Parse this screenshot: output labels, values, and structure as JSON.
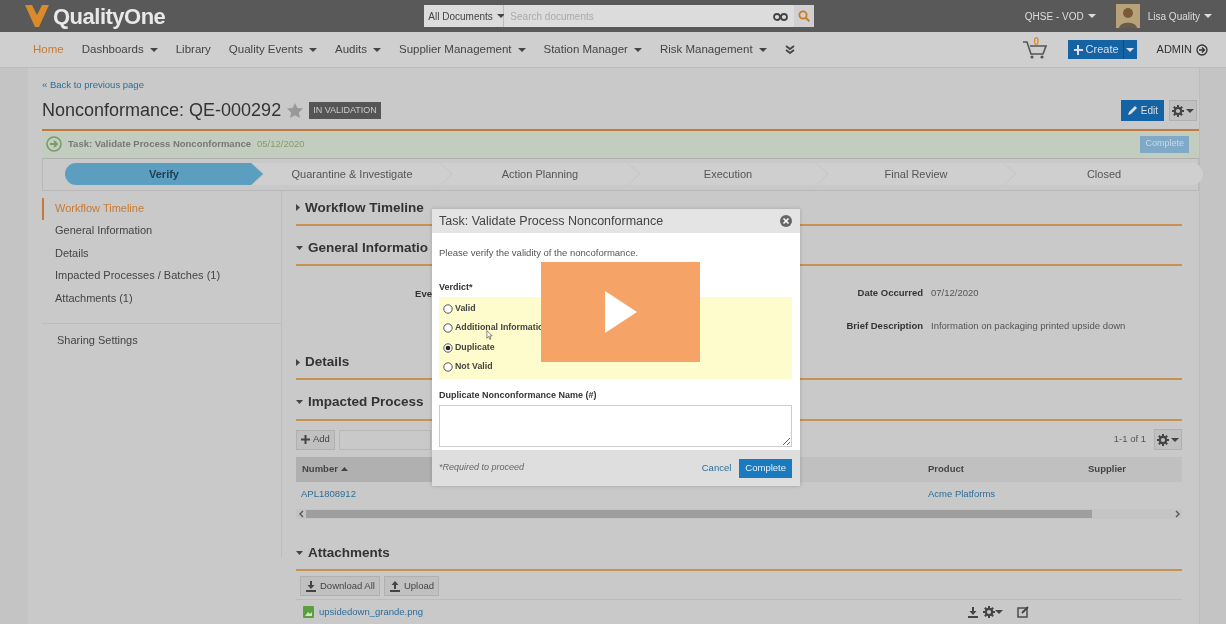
{
  "app": {
    "logo": "QualityOne",
    "search_scope": "All Documents",
    "search_placeholder": "Search documents",
    "vault": "QHSE - VOD",
    "user": "Lisa Quality"
  },
  "nav": {
    "items": [
      {
        "label": "Home",
        "selected": true,
        "dropdown": false
      },
      {
        "label": "Dashboards",
        "selected": false,
        "dropdown": true
      },
      {
        "label": "Library",
        "selected": false,
        "dropdown": false
      },
      {
        "label": "Quality Events",
        "selected": false,
        "dropdown": true
      },
      {
        "label": "Audits",
        "selected": false,
        "dropdown": true
      },
      {
        "label": "Supplier Management",
        "selected": false,
        "dropdown": true
      },
      {
        "label": "Station Manager",
        "selected": false,
        "dropdown": true
      },
      {
        "label": "Risk Management",
        "selected": false,
        "dropdown": true
      }
    ],
    "cart_count": "0",
    "create": "Create",
    "admin": "ADMIN"
  },
  "page": {
    "back": "« Back to previous page",
    "title": "Nonconformance: QE-000292",
    "status": "IN VALIDATION",
    "edit": "Edit"
  },
  "task": {
    "label": "Task: Validate Process Nonconformance",
    "date": "05/12/2020",
    "button": "Complete"
  },
  "stages": [
    {
      "label": "Verify",
      "selected": true
    },
    {
      "label": "Quarantine & Investigate",
      "selected": false
    },
    {
      "label": "Action Planning",
      "selected": false
    },
    {
      "label": "Execution",
      "selected": false
    },
    {
      "label": "Final Review",
      "selected": false
    },
    {
      "label": "Closed",
      "selected": false
    }
  ],
  "sidebar": {
    "items": [
      {
        "label": "Workflow Timeline",
        "selected": true
      },
      {
        "label": "General Information",
        "selected": false
      },
      {
        "label": "Details",
        "selected": false
      },
      {
        "label": "Impacted Processes / Batches (1)",
        "selected": false
      },
      {
        "label": "Attachments (1)",
        "selected": false
      }
    ],
    "sharing": "Sharing Settings"
  },
  "sections": [
    {
      "title": "Workflow Timeline",
      "expanded": false
    },
    {
      "kind": "fields",
      "title": "General Informatio",
      "expanded": true,
      "left_fields": [
        {
          "label": "Eve"
        }
      ],
      "right_fields": [
        {
          "label": "Date Occurred",
          "value": "07/12/2020"
        },
        {
          "label": "Brief Description",
          "value": "Information on packaging printed upside down"
        }
      ]
    },
    {
      "title": "Details",
      "expanded": false
    },
    {
      "kind": "table",
      "title": "Impacted Process",
      "expanded": true,
      "add": "Add",
      "count": "1-1 of 1",
      "columns": [
        {
          "label": "Number",
          "sorted": true
        },
        {
          "label": "Product",
          "sorted": false
        },
        {
          "label": "Supplier",
          "sorted": false
        }
      ],
      "rows": [
        {
          "number": "APL1808912",
          "product": "Acme Platforms"
        }
      ]
    },
    {
      "kind": "attachments",
      "title": "Attachments",
      "expanded": true,
      "buttons": [
        "Download All",
        "Upload"
      ],
      "files": [
        "upsidedown_grande.png"
      ]
    }
  ],
  "modal": {
    "title": "Task: Validate Process Nonconformance",
    "instructions": "Please verify the validity of the noncoformance.",
    "verdict_label": "Verdict*",
    "options": [
      {
        "label": "Valid",
        "selected": false
      },
      {
        "label": "Additional Informatio",
        "selected": false
      },
      {
        "label": "Duplicate",
        "selected": true
      },
      {
        "label": "Not Valid",
        "selected": false
      }
    ],
    "name_label": "Duplicate Nonconformance Name (#)",
    "note": "*Required to proceed",
    "cancel": "Cancel",
    "complete": "Complete"
  }
}
